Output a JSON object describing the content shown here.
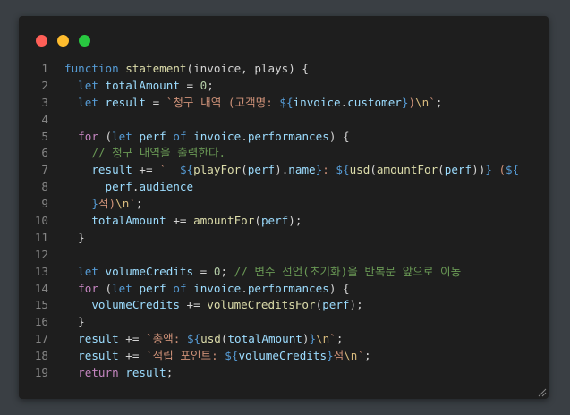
{
  "window": {
    "controls": [
      {
        "name": "close",
        "color": "#ff5f57"
      },
      {
        "name": "minimize",
        "color": "#febc2e"
      },
      {
        "name": "maximize",
        "color": "#28c840"
      }
    ]
  },
  "code": {
    "lines": [
      {
        "n": "1",
        "tokens": [
          [
            "kw",
            "function"
          ],
          [
            "pl",
            " "
          ],
          [
            "fn",
            "statement"
          ],
          [
            "pl",
            "(invoice, plays) {"
          ]
        ]
      },
      {
        "n": "2",
        "tokens": [
          [
            "pl",
            "  "
          ],
          [
            "kw",
            "let"
          ],
          [
            "pl",
            " "
          ],
          [
            "var",
            "totalAmount"
          ],
          [
            "pl",
            " = "
          ],
          [
            "num",
            "0"
          ],
          [
            "pl",
            ";"
          ]
        ]
      },
      {
        "n": "3",
        "tokens": [
          [
            "pl",
            "  "
          ],
          [
            "kw",
            "let"
          ],
          [
            "pl",
            " "
          ],
          [
            "var",
            "result"
          ],
          [
            "pl",
            " = "
          ],
          [
            "str",
            "`청구 내역 (고객명: "
          ],
          [
            "tpl",
            "${"
          ],
          [
            "var",
            "invoice"
          ],
          [
            "pl",
            "."
          ],
          [
            "var",
            "customer"
          ],
          [
            "tpl",
            "}"
          ],
          [
            "str",
            ")"
          ],
          [
            "esc",
            "\\n"
          ],
          [
            "str",
            "`"
          ],
          [
            "pl",
            ";"
          ]
        ]
      },
      {
        "n": "4",
        "tokens": []
      },
      {
        "n": "5",
        "tokens": [
          [
            "pl",
            "  "
          ],
          [
            "ctl",
            "for"
          ],
          [
            "pl",
            " ("
          ],
          [
            "kw",
            "let"
          ],
          [
            "pl",
            " "
          ],
          [
            "var",
            "perf"
          ],
          [
            "pl",
            " "
          ],
          [
            "kw",
            "of"
          ],
          [
            "pl",
            " "
          ],
          [
            "var",
            "invoice"
          ],
          [
            "pl",
            "."
          ],
          [
            "var",
            "performances"
          ],
          [
            "pl",
            ") {"
          ]
        ]
      },
      {
        "n": "6",
        "tokens": [
          [
            "pl",
            "    "
          ],
          [
            "com",
            "// 청구 내역을 출력한다."
          ]
        ]
      },
      {
        "n": "7",
        "tokens": [
          [
            "pl",
            "    "
          ],
          [
            "var",
            "result"
          ],
          [
            "pl",
            " += "
          ],
          [
            "str",
            "`  "
          ],
          [
            "tpl",
            "${"
          ],
          [
            "fn",
            "playFor"
          ],
          [
            "pl",
            "("
          ],
          [
            "var",
            "perf"
          ],
          [
            "pl",
            ")."
          ],
          [
            "var",
            "name"
          ],
          [
            "tpl",
            "}"
          ],
          [
            "str",
            ": "
          ],
          [
            "tpl",
            "${"
          ],
          [
            "fn",
            "usd"
          ],
          [
            "pl",
            "("
          ],
          [
            "fn",
            "amountFor"
          ],
          [
            "pl",
            "("
          ],
          [
            "var",
            "perf"
          ],
          [
            "pl",
            "))"
          ],
          [
            "tpl",
            "}"
          ],
          [
            "str",
            " ("
          ],
          [
            "tpl",
            "${"
          ]
        ]
      },
      {
        "n": "8",
        "tokens": [
          [
            "pl",
            "      "
          ],
          [
            "var",
            "perf"
          ],
          [
            "pl",
            "."
          ],
          [
            "var",
            "audience"
          ]
        ]
      },
      {
        "n": "9",
        "tokens": [
          [
            "pl",
            "    "
          ],
          [
            "tpl",
            "}"
          ],
          [
            "str",
            "석)"
          ],
          [
            "esc",
            "\\n"
          ],
          [
            "str",
            "`"
          ],
          [
            "pl",
            ";"
          ]
        ]
      },
      {
        "n": "10",
        "tokens": [
          [
            "pl",
            "    "
          ],
          [
            "var",
            "totalAmount"
          ],
          [
            "pl",
            " += "
          ],
          [
            "fn",
            "amountFor"
          ],
          [
            "pl",
            "("
          ],
          [
            "var",
            "perf"
          ],
          [
            "pl",
            ");"
          ]
        ]
      },
      {
        "n": "11",
        "tokens": [
          [
            "pl",
            "  }"
          ]
        ]
      },
      {
        "n": "12",
        "tokens": []
      },
      {
        "n": "13",
        "tokens": [
          [
            "pl",
            "  "
          ],
          [
            "kw",
            "let"
          ],
          [
            "pl",
            " "
          ],
          [
            "var",
            "volumeCredits"
          ],
          [
            "pl",
            " = "
          ],
          [
            "num",
            "0"
          ],
          [
            "pl",
            "; "
          ],
          [
            "com",
            "// 변수 선언(초기화)을 반복문 앞으로 이동"
          ]
        ]
      },
      {
        "n": "14",
        "tokens": [
          [
            "pl",
            "  "
          ],
          [
            "ctl",
            "for"
          ],
          [
            "pl",
            " ("
          ],
          [
            "kw",
            "let"
          ],
          [
            "pl",
            " "
          ],
          [
            "var",
            "perf"
          ],
          [
            "pl",
            " "
          ],
          [
            "kw",
            "of"
          ],
          [
            "pl",
            " "
          ],
          [
            "var",
            "invoice"
          ],
          [
            "pl",
            "."
          ],
          [
            "var",
            "performances"
          ],
          [
            "pl",
            ") {"
          ]
        ]
      },
      {
        "n": "15",
        "tokens": [
          [
            "pl",
            "    "
          ],
          [
            "var",
            "volumeCredits"
          ],
          [
            "pl",
            " += "
          ],
          [
            "fn",
            "volumeCreditsFor"
          ],
          [
            "pl",
            "("
          ],
          [
            "var",
            "perf"
          ],
          [
            "pl",
            ");"
          ]
        ]
      },
      {
        "n": "16",
        "tokens": [
          [
            "pl",
            "  }"
          ]
        ]
      },
      {
        "n": "17",
        "tokens": [
          [
            "pl",
            "  "
          ],
          [
            "var",
            "result"
          ],
          [
            "pl",
            " += "
          ],
          [
            "str",
            "`총액: "
          ],
          [
            "tpl",
            "${"
          ],
          [
            "fn",
            "usd"
          ],
          [
            "pl",
            "("
          ],
          [
            "var",
            "totalAmount"
          ],
          [
            "pl",
            ")"
          ],
          [
            "tpl",
            "}"
          ],
          [
            "esc",
            "\\n"
          ],
          [
            "str",
            "`"
          ],
          [
            "pl",
            ";"
          ]
        ]
      },
      {
        "n": "18",
        "tokens": [
          [
            "pl",
            "  "
          ],
          [
            "var",
            "result"
          ],
          [
            "pl",
            " += "
          ],
          [
            "str",
            "`적립 포인트: "
          ],
          [
            "tpl",
            "${"
          ],
          [
            "var",
            "volumeCredits"
          ],
          [
            "tpl",
            "}"
          ],
          [
            "str",
            "점"
          ],
          [
            "esc",
            "\\n"
          ],
          [
            "str",
            "`"
          ],
          [
            "pl",
            ";"
          ]
        ]
      },
      {
        "n": "19",
        "tokens": [
          [
            "pl",
            "  "
          ],
          [
            "ctl",
            "return"
          ],
          [
            "pl",
            " "
          ],
          [
            "var",
            "result"
          ],
          [
            "pl",
            ";"
          ]
        ]
      }
    ]
  }
}
